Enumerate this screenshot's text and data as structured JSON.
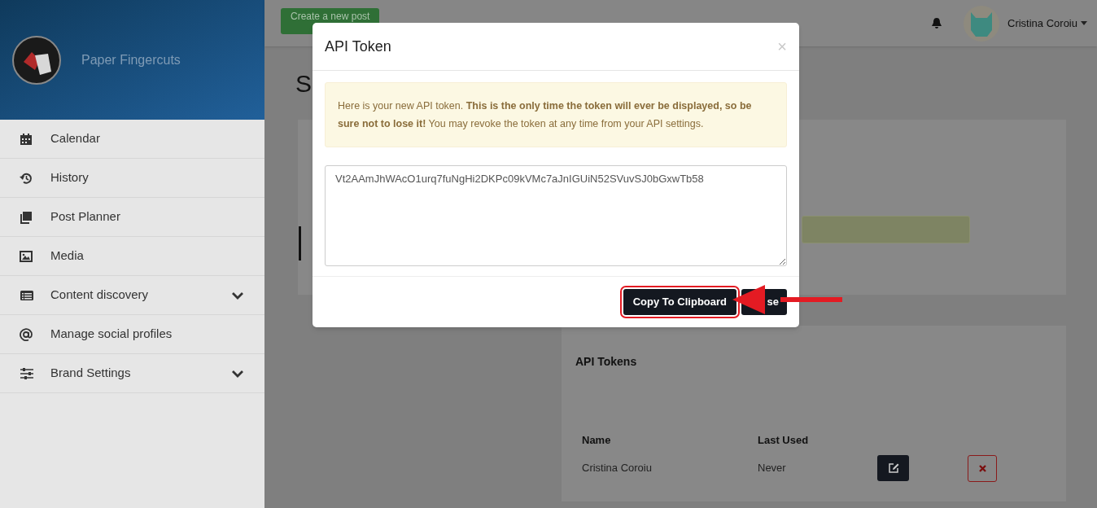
{
  "brand": {
    "name": "Paper Fingercuts"
  },
  "sidebar": {
    "items": [
      {
        "label": "Calendar",
        "kind": "link"
      },
      {
        "label": "History",
        "kind": "link"
      },
      {
        "label": "Post Planner",
        "kind": "link"
      },
      {
        "label": "Media",
        "kind": "link"
      },
      {
        "label": "Content discovery",
        "kind": "dropdown"
      },
      {
        "label": "Manage social profiles",
        "kind": "link"
      },
      {
        "label": "Brand Settings",
        "kind": "dropdown"
      }
    ]
  },
  "topbar": {
    "create_button": "Create a new post",
    "user": "Cristina Coroiu"
  },
  "page": {
    "title": "S"
  },
  "tokens_card": {
    "title": "API Tokens",
    "columns": [
      "Name",
      "Last Used"
    ],
    "rows": [
      {
        "name": "Cristina Coroiu",
        "last_used": "Never"
      }
    ]
  },
  "modal": {
    "title": "API Token",
    "close": "×",
    "alert": "Here is your new API token. **This is the only time the token will ever be displayed, so be sure not to lose it!** You may revoke the token at any time from your API settings.",
    "token": "Vt2AAmJhWAcO1urq7fuNgHi2DKPc09kVMc7aJnIGUiN52SVuvSJ0bGxwTb58",
    "buttons": [
      {
        "label": "Copy To Clipboard",
        "highlighted": true
      },
      {
        "label": "se",
        "highlighted": false
      }
    ]
  }
}
